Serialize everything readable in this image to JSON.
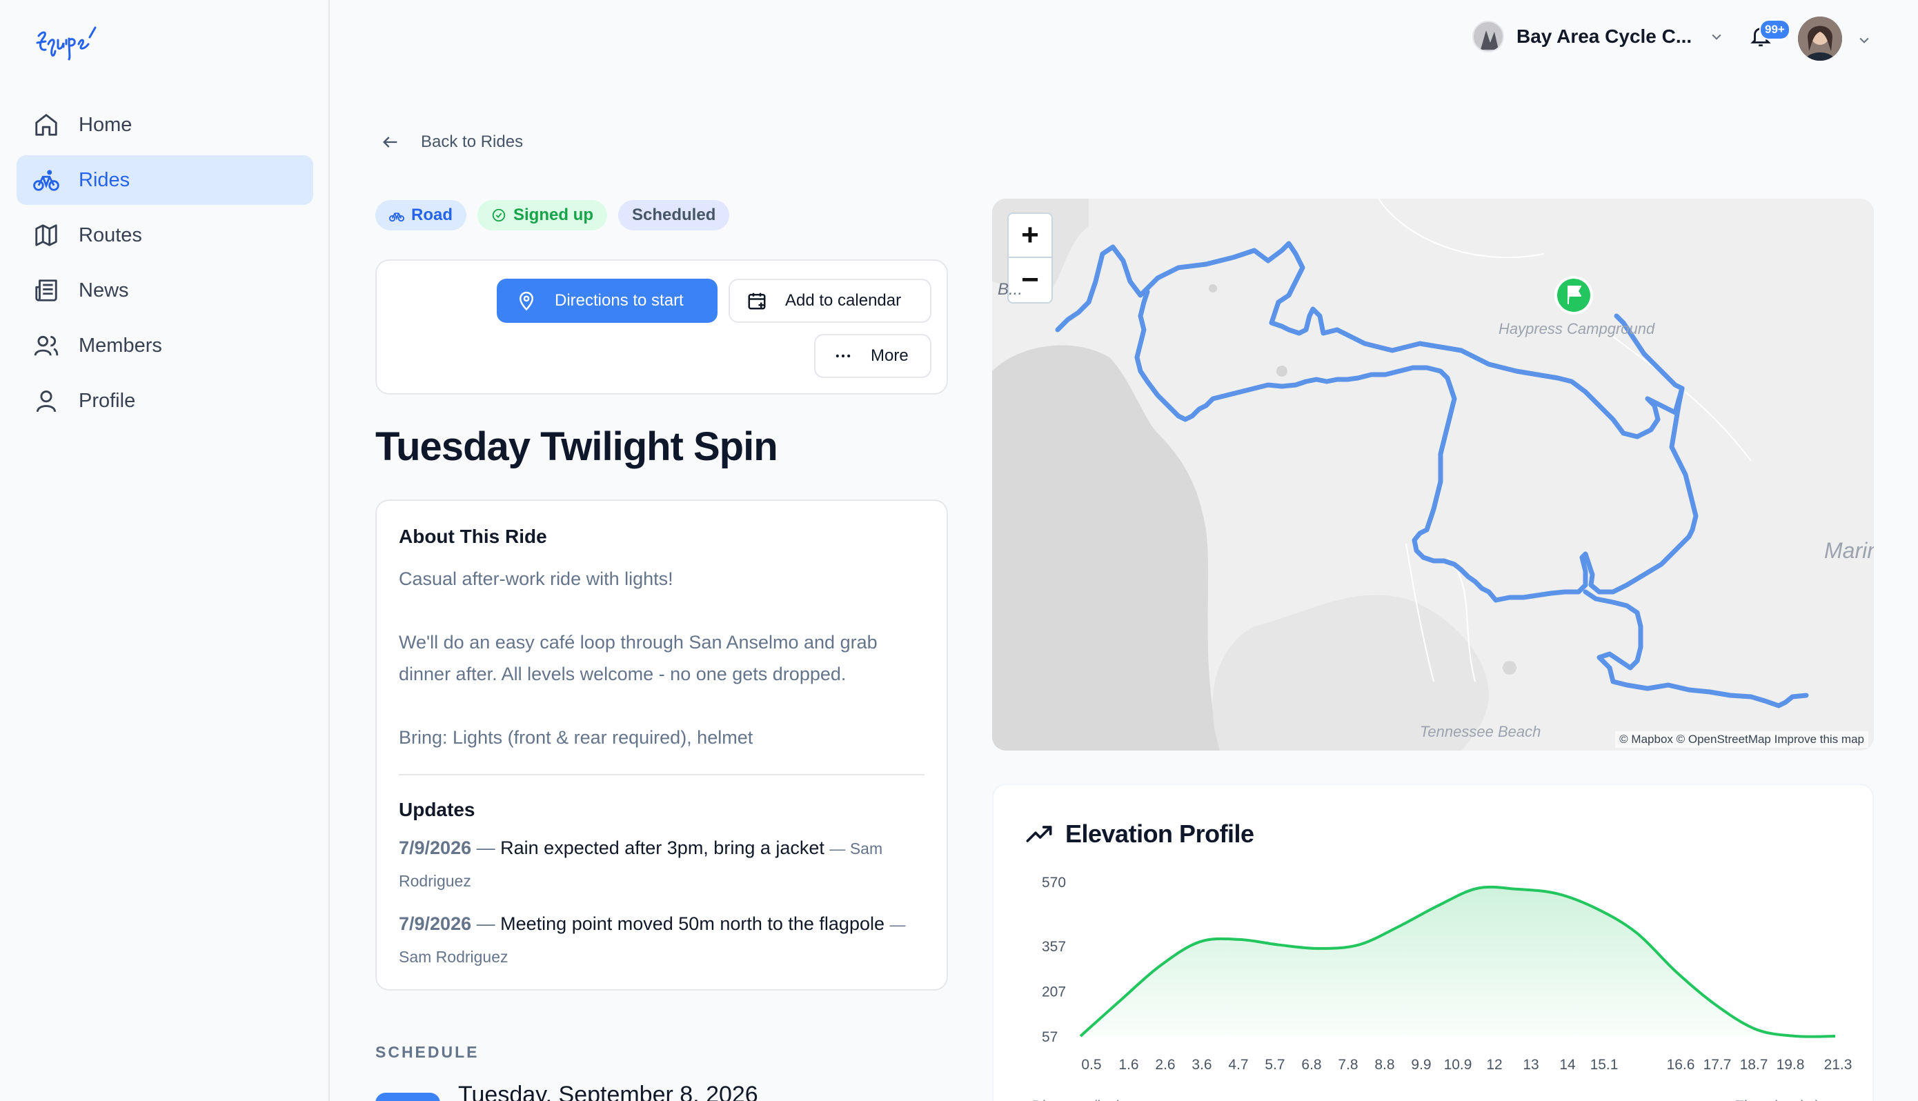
{
  "app": {
    "logo_text": "Equipe"
  },
  "sidebar": {
    "items": [
      {
        "label": "Home",
        "icon": "home-icon"
      },
      {
        "label": "Rides",
        "icon": "bike-icon",
        "active": true
      },
      {
        "label": "Routes",
        "icon": "map-icon"
      },
      {
        "label": "News",
        "icon": "newspaper-icon"
      },
      {
        "label": "Members",
        "icon": "users-icon"
      },
      {
        "label": "Profile",
        "icon": "user-icon"
      }
    ]
  },
  "topbar": {
    "club_name": "Bay Area Cycle C...",
    "notification_count": "99+"
  },
  "back_link": "Back to Rides",
  "tags": {
    "road": "Road",
    "signed_up": "Signed up",
    "scheduled": "Scheduled"
  },
  "actions": {
    "directions": "Directions to start",
    "calendar": "Add to calendar",
    "more": "More"
  },
  "ride": {
    "title": "Tuesday Twilight Spin",
    "about_heading": "About This Ride",
    "description": [
      "Casual after-work ride with lights!",
      "We'll do an easy café loop through San Anselmo and grab dinner after. All levels welcome - no one gets dropped.",
      "Bring: Lights (front & rear required), helmet"
    ],
    "updates_heading": "Updates",
    "updates": [
      {
        "date": "7/9/2026",
        "text": "Rain expected after 3pm, bring a jacket",
        "author": "Sam Rodriguez"
      },
      {
        "date": "7/9/2026",
        "text": "Meeting point moved 50m north to the flagpole",
        "author": "Sam Rodriguez"
      }
    ]
  },
  "schedule": {
    "label": "SCHEDULE",
    "date": "Tuesday, September 8, 2026"
  },
  "map": {
    "zoom_in": "+",
    "zoom_out": "−",
    "labels": {
      "campground": "Haypress Campground",
      "beach": "Tennessee Beach",
      "marin": "Marin",
      "partial": "B..."
    },
    "attribution": "© Mapbox © OpenStreetMap Improve this map",
    "route_color": "#5b93e8",
    "flag_color": "#22c55e"
  },
  "elevation": {
    "title": "Elevation Profile",
    "xlabel": "Distance (km)",
    "ylabel": "Elevation (m)"
  },
  "chart_data": {
    "type": "area",
    "title": "Elevation Profile",
    "xlabel": "Distance (km)",
    "ylabel": "Elevation (m)",
    "y_ticks": [
      57,
      207,
      357,
      570
    ],
    "x_ticks": [
      "0.5",
      "1.6",
      "2.6",
      "3.6",
      "4.7",
      "5.7",
      "6.8",
      "7.8",
      "8.8",
      "9.9",
      "10.9",
      "12",
      "13",
      "14",
      "15.1",
      "16.6",
      "17.7",
      "18.7",
      "19.8",
      "21.3"
    ],
    "x": [
      0.5,
      1.6,
      2.6,
      3.6,
      4.7,
      5.7,
      6.8,
      7.8,
      8.8,
      9.9,
      10.9,
      12,
      13,
      14,
      15.1,
      16.6,
      17.7,
      18.7,
      19.8,
      21.3
    ],
    "values": [
      57,
      175,
      290,
      370,
      378,
      360,
      348,
      360,
      420,
      490,
      548,
      545,
      530,
      480,
      400,
      270,
      160,
      80,
      57,
      57
    ],
    "ylim": [
      57,
      570
    ],
    "color": "#22c55e"
  }
}
